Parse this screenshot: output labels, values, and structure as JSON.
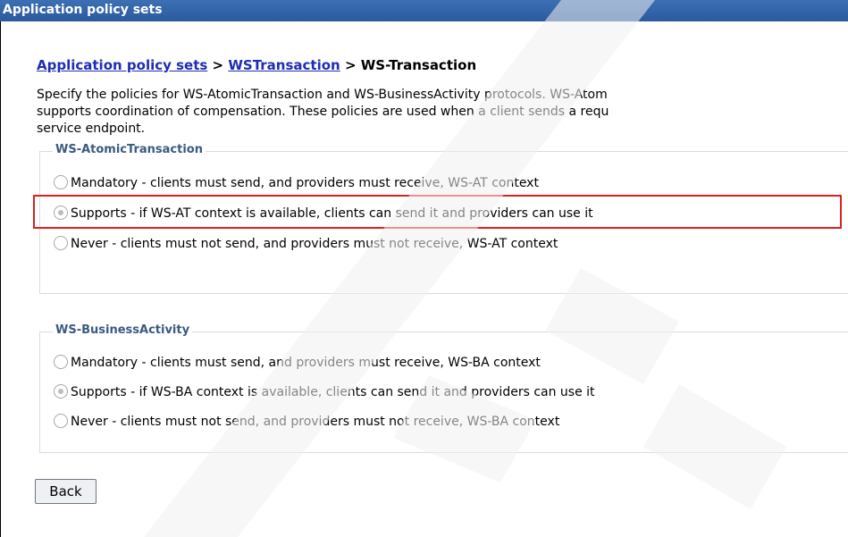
{
  "window": {
    "title": "Application policy sets"
  },
  "breadcrumb": {
    "link1": "Application policy sets",
    "sep1": " > ",
    "link2": "WSTransaction",
    "sep2": " > ",
    "current": "WS-Transaction"
  },
  "description": {
    "line1": "Specify the policies for WS-AtomicTransaction and WS-BusinessActivity protocols. WS-Atom",
    "line2": "supports coordination of compensation. These policies are used when a client sends a requ",
    "line3": "service endpoint."
  },
  "at_group": {
    "legend": "WS-AtomicTransaction",
    "options": [
      {
        "label": "Mandatory - clients must send, and providers must receive, WS-AT context",
        "selected": false
      },
      {
        "label": "Supports - if WS-AT context is available, clients can send it and providers can use it",
        "selected": true
      },
      {
        "label": "Never - clients must not send, and providers must not receive, WS-AT context",
        "selected": false
      }
    ]
  },
  "ba_group": {
    "legend": "WS-BusinessActivity",
    "options": [
      {
        "label": "Mandatory - clients must send, and providers must receive, WS-BA context",
        "selected": false
      },
      {
        "label": "Supports - if WS-BA context is available, clients can send it and providers can use it",
        "selected": true
      },
      {
        "label": "Never - clients must not send, and providers must not receive, WS-BA context",
        "selected": false
      }
    ]
  },
  "buttons": {
    "back": "Back"
  },
  "colors": {
    "titlebar": "#2f62a8",
    "link": "#1e2db4",
    "highlight_box": "#e02020",
    "legend": "#3a5a80"
  }
}
